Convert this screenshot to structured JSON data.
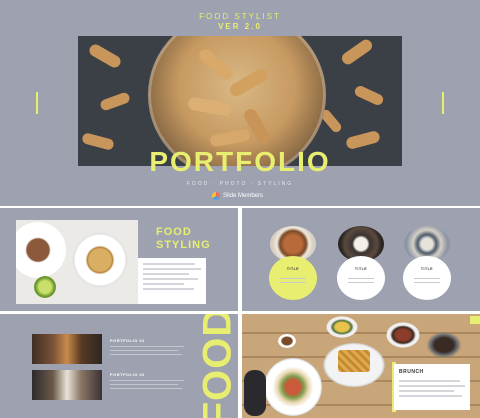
{
  "hero": {
    "subtitle": "FOOD STYLIST",
    "version": "VER 2.0",
    "title": "PORTFOLIO",
    "tagline": "FOOD · PHOTO · STYLING",
    "logo_text": "Slide Members"
  },
  "food_styling": {
    "title_line1": "FOOD",
    "title_line2": "STYLING"
  },
  "three_circles": {
    "items": [
      {
        "label": "TITLE"
      },
      {
        "label": "TITLE"
      },
      {
        "label": "TITLE"
      }
    ]
  },
  "portfolio_list": {
    "items": [
      {
        "label": "PORTFOLIO 01"
      },
      {
        "label": "PORTFOLIO 02"
      }
    ],
    "side_word": "FOOD"
  },
  "brunch": {
    "title": "BRUNCH"
  },
  "colors": {
    "slide_bg": "#9ea1b0",
    "accent": "#e8ee70",
    "text_white": "#ffffff"
  }
}
